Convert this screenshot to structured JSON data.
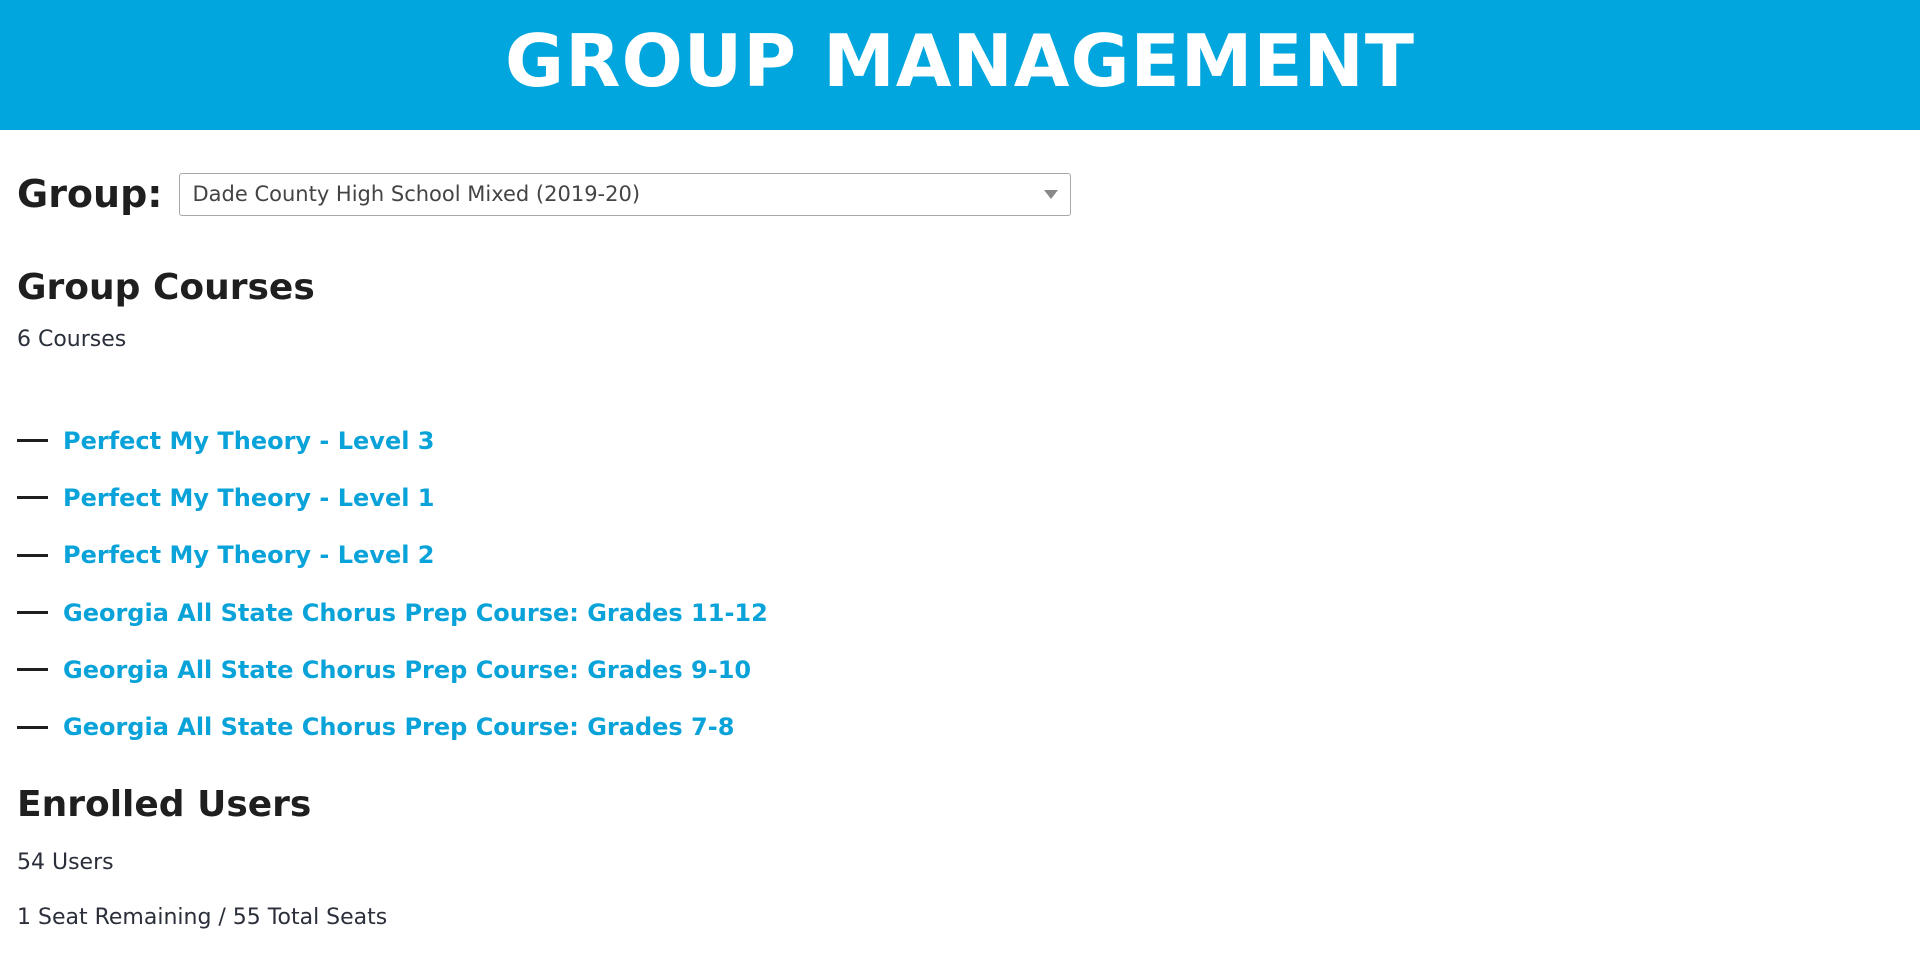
{
  "header": {
    "title": "GROUP MANAGEMENT"
  },
  "group": {
    "label": "Group:",
    "selected": "Dade County High School Mixed (2019-20)"
  },
  "courses": {
    "title": "Group Courses",
    "count": "6 Courses",
    "items": [
      "Perfect My Theory - Level 3",
      "Perfect My Theory - Level 1",
      "Perfect My Theory - Level 2",
      "Georgia All State Chorus Prep Course: Grades 11-12",
      "Georgia All State Chorus Prep Course: Grades 9-10",
      "Georgia All State Chorus Prep Course: Grades 7-8"
    ]
  },
  "users": {
    "title": "Enrolled Users",
    "count": "54 Users",
    "seats": "1 Seat Remaining / 55 Total Seats"
  },
  "colors": {
    "header_bg": "#00a6dd",
    "link": "#0aa3d9"
  }
}
